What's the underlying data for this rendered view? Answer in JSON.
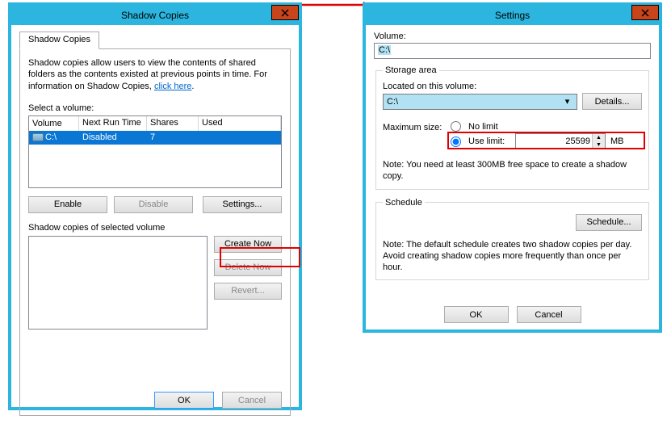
{
  "shadow": {
    "title": "Shadow Copies",
    "tab": "Shadow Copies",
    "desc1": "Shadow copies allow users to view the contents of shared folders as the contents existed at previous points in time. For information on Shadow Copies, ",
    "desc_link": "click here",
    "select_label": "Select a volume:",
    "columns": {
      "volume": "Volume",
      "nrt": "Next Run Time",
      "shares": "Shares",
      "used": "Used"
    },
    "row": {
      "volume": "C:\\",
      "nrt": "Disabled",
      "shares": "7",
      "used": ""
    },
    "btn_enable": "Enable",
    "btn_disable": "Disable",
    "btn_settings": "Settings...",
    "selected_label": "Shadow copies of selected volume",
    "btn_create": "Create Now",
    "btn_delete": "Delete Now",
    "btn_revert": "Revert...",
    "ok": "OK",
    "cancel": "Cancel"
  },
  "settings": {
    "title": "Settings",
    "volume_label": "Volume:",
    "volume_value": "C:\\",
    "storage_legend": "Storage area",
    "located_label": "Located on this volume:",
    "located_value": "C:\\",
    "details": "Details...",
    "max_label": "Maximum size:",
    "nolimit": "No limit",
    "uselimit": "Use limit:",
    "limit_value": "25599",
    "limit_unit": "MB",
    "storage_note": "Note: You need at least 300MB free space to create a shadow copy.",
    "schedule_legend": "Schedule",
    "schedule_btn": "Schedule...",
    "schedule_note": "Note: The default schedule creates two shadow copies per day. Avoid creating shadow copies more frequently than once per hour.",
    "ok": "OK",
    "cancel": "Cancel"
  }
}
